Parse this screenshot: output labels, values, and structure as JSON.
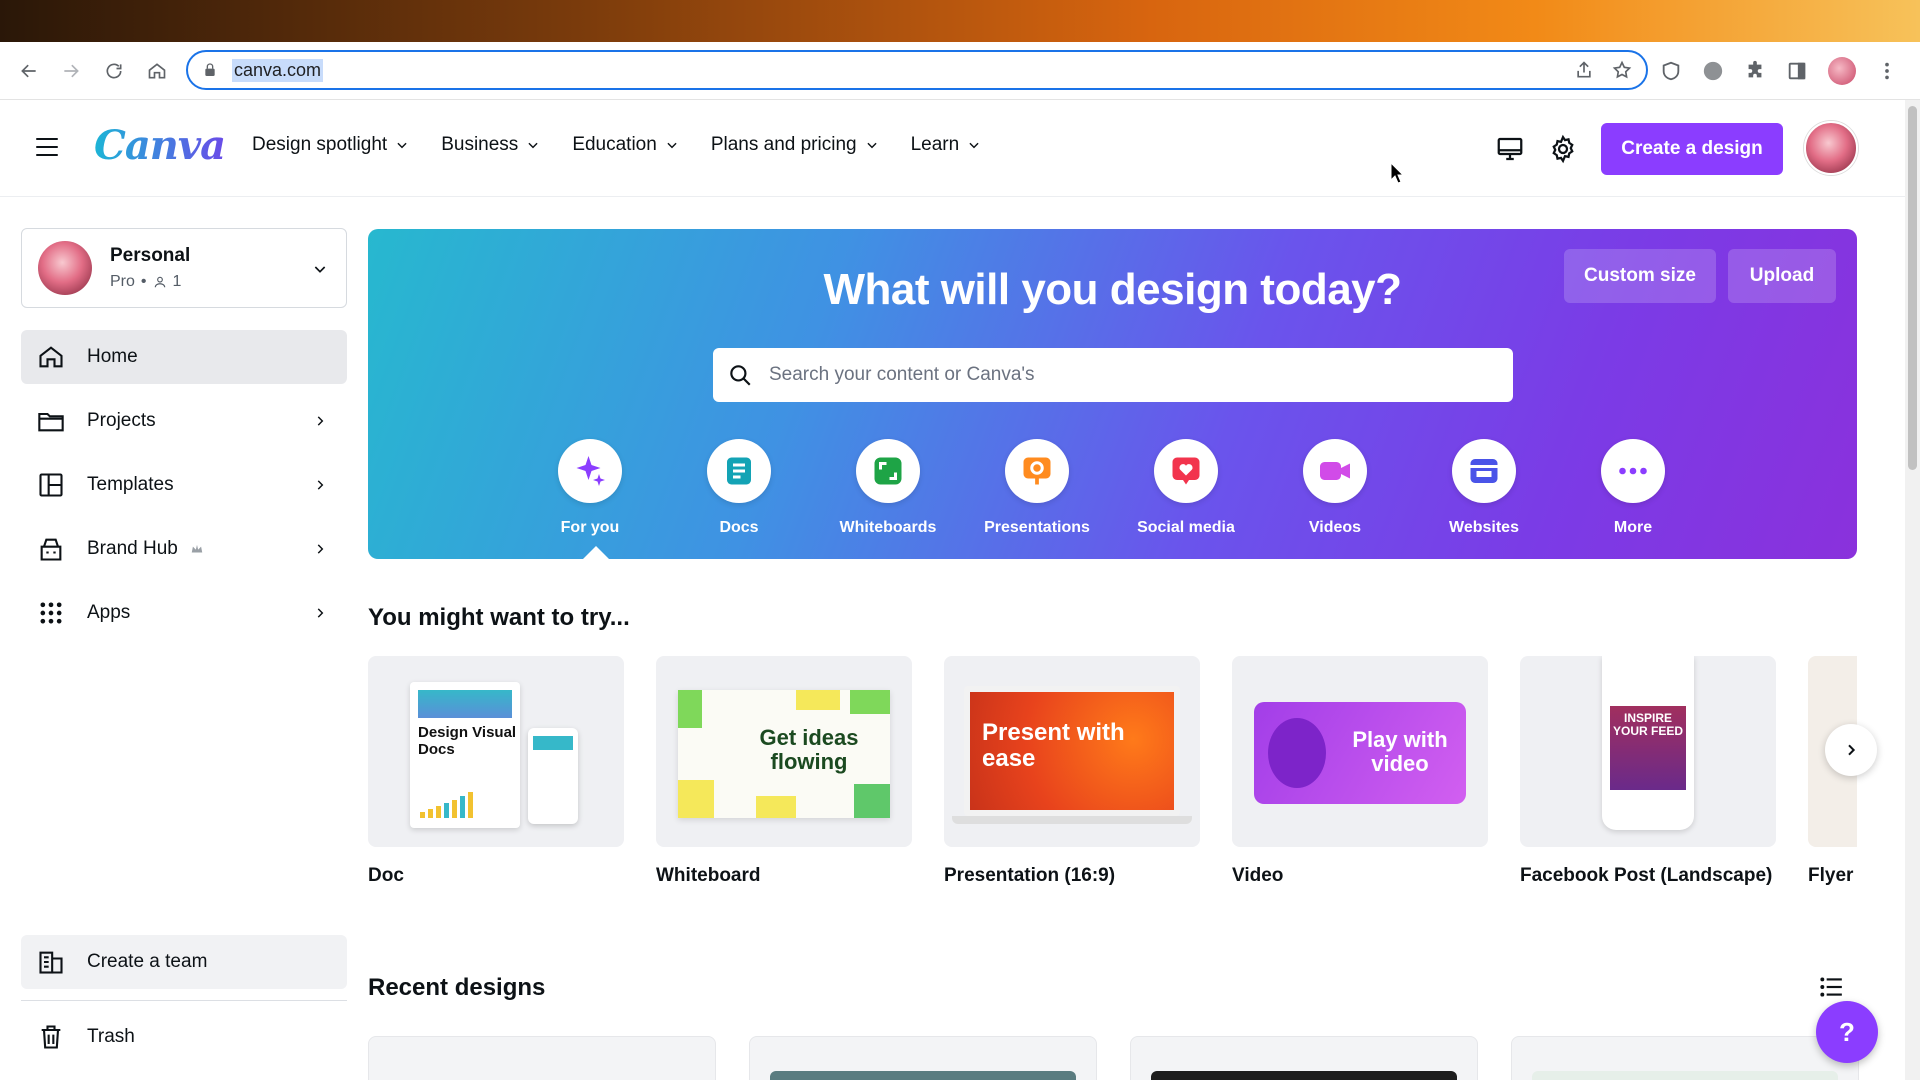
{
  "browser": {
    "url": "canva.com"
  },
  "header": {
    "logo": "Canva",
    "nav": [
      {
        "label": "Design spotlight"
      },
      {
        "label": "Business"
      },
      {
        "label": "Education"
      },
      {
        "label": "Plans and pricing"
      },
      {
        "label": "Learn"
      }
    ],
    "create_button": "Create a design"
  },
  "sidebar": {
    "team": {
      "name": "Personal",
      "plan": "Pro",
      "members": "1"
    },
    "items": [
      {
        "label": "Home",
        "icon": "home-icon",
        "active": true
      },
      {
        "label": "Projects",
        "icon": "folder-icon"
      },
      {
        "label": "Templates",
        "icon": "templates-icon"
      },
      {
        "label": "Brand Hub",
        "icon": "brand-hub-icon"
      },
      {
        "label": "Apps",
        "icon": "apps-grid-icon"
      }
    ],
    "create_team": "Create a team",
    "trash": "Trash"
  },
  "hero": {
    "title": "What will you design today?",
    "custom_size": "Custom size",
    "upload": "Upload",
    "search_placeholder": "Search your content or Canva's",
    "categories": [
      {
        "label": "For you",
        "icon": "sparkle-icon",
        "color": "#8b3dff"
      },
      {
        "label": "Docs",
        "icon": "doc-icon",
        "color": "#13a3b5"
      },
      {
        "label": "Whiteboards",
        "icon": "whiteboard-icon",
        "color": "#1ea446"
      },
      {
        "label": "Presentations",
        "icon": "presentation-icon",
        "color": "#ff8b1f"
      },
      {
        "label": "Social media",
        "icon": "heart-icon",
        "color": "#f2344d"
      },
      {
        "label": "Videos",
        "icon": "video-icon",
        "color": "#d14be8"
      },
      {
        "label": "Websites",
        "icon": "website-icon",
        "color": "#4a54e8"
      },
      {
        "label": "More",
        "icon": "more-icon",
        "color": "#8b3dff"
      }
    ]
  },
  "try_section": {
    "title": "You might want to try...",
    "cards": [
      {
        "label": "Doc",
        "thumb_text": "Design Visual Docs"
      },
      {
        "label": "Whiteboard",
        "thumb_text": "Get ideas flowing"
      },
      {
        "label": "Presentation (16:9)",
        "thumb_text": "Present with ease"
      },
      {
        "label": "Video",
        "thumb_text": "Play with video"
      },
      {
        "label": "Facebook Post (Landscape)",
        "thumb_text": "INSPIRE YOUR FEED"
      },
      {
        "label": "Flyer"
      }
    ]
  },
  "recent": {
    "title": "Recent designs"
  },
  "help": "?",
  "colors": {
    "accent": "#8b3dff",
    "text": "#0d1216"
  }
}
